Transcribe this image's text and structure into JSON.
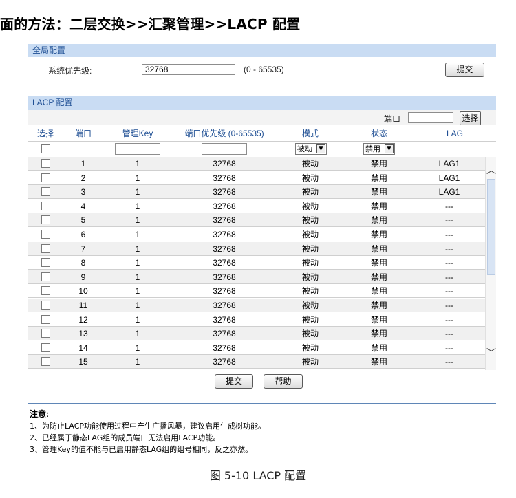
{
  "heading": "面的方法：二层交换>>汇聚管理>>LACP 配置",
  "global": {
    "section_title": "全局配置",
    "priority_label": "系统优先级:",
    "priority_value": "32768",
    "priority_range": "(0 - 65535)",
    "submit_label": "提交"
  },
  "lacp": {
    "section_title": "LACP 配置",
    "port_search_label": "端口",
    "port_search_value": "",
    "select_button_label": "选择",
    "columns": [
      "选择",
      "端口",
      "管理Key",
      "端口优先级 (0-65535)",
      "模式",
      "状态",
      "LAG"
    ],
    "filter": {
      "mode_selected": "被动",
      "status_selected": "禁用"
    },
    "rows": [
      {
        "port": "1",
        "key": "1",
        "priority": "32768",
        "mode": "被动",
        "status": "禁用",
        "lag": "LAG1"
      },
      {
        "port": "2",
        "key": "1",
        "priority": "32768",
        "mode": "被动",
        "status": "禁用",
        "lag": "LAG1"
      },
      {
        "port": "3",
        "key": "1",
        "priority": "32768",
        "mode": "被动",
        "status": "禁用",
        "lag": "LAG1"
      },
      {
        "port": "4",
        "key": "1",
        "priority": "32768",
        "mode": "被动",
        "status": "禁用",
        "lag": "---"
      },
      {
        "port": "5",
        "key": "1",
        "priority": "32768",
        "mode": "被动",
        "status": "禁用",
        "lag": "---"
      },
      {
        "port": "6",
        "key": "1",
        "priority": "32768",
        "mode": "被动",
        "status": "禁用",
        "lag": "---"
      },
      {
        "port": "7",
        "key": "1",
        "priority": "32768",
        "mode": "被动",
        "status": "禁用",
        "lag": "---"
      },
      {
        "port": "8",
        "key": "1",
        "priority": "32768",
        "mode": "被动",
        "status": "禁用",
        "lag": "---"
      },
      {
        "port": "9",
        "key": "1",
        "priority": "32768",
        "mode": "被动",
        "status": "禁用",
        "lag": "---"
      },
      {
        "port": "10",
        "key": "1",
        "priority": "32768",
        "mode": "被动",
        "status": "禁用",
        "lag": "---"
      },
      {
        "port": "11",
        "key": "1",
        "priority": "32768",
        "mode": "被动",
        "status": "禁用",
        "lag": "---"
      },
      {
        "port": "12",
        "key": "1",
        "priority": "32768",
        "mode": "被动",
        "status": "禁用",
        "lag": "---"
      },
      {
        "port": "13",
        "key": "1",
        "priority": "32768",
        "mode": "被动",
        "status": "禁用",
        "lag": "---"
      },
      {
        "port": "14",
        "key": "1",
        "priority": "32768",
        "mode": "被动",
        "status": "禁用",
        "lag": "---"
      },
      {
        "port": "15",
        "key": "1",
        "priority": "32768",
        "mode": "被动",
        "status": "禁用",
        "lag": "---"
      }
    ],
    "submit_label": "提交",
    "help_label": "帮助"
  },
  "notes": {
    "title": "注意:",
    "items": [
      "1、为防止LACP功能使用过程中产生广播风暴，建议启用生成树功能。",
      "2、已经属于静态LAG组的成员端口无法启用LACP功能。",
      "3、管理Key的值不能与已启用静态LAG组的组号相同，反之亦然。"
    ]
  },
  "caption": "图  5-10 LACP 配置",
  "colors": {
    "section_bar": "#c9dcf3",
    "header_text": "#1f4f94",
    "note_rule": "#5f86b7"
  }
}
